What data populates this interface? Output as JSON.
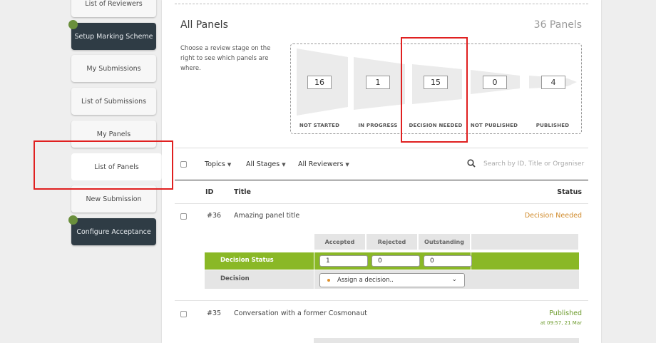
{
  "sidebar": {
    "items": [
      {
        "label": "List of Reviewers"
      },
      {
        "label": "Setup Marking Scheme"
      },
      {
        "label": "My Submissions"
      },
      {
        "label": "List of Submissions"
      },
      {
        "label": "My Panels"
      },
      {
        "label": "List of Panels"
      },
      {
        "label": "New Submission"
      },
      {
        "label": "Configure Acceptance"
      }
    ]
  },
  "header": {
    "title": "All Panels",
    "count": "36 Panels",
    "help": "Choose a review stage on the right to see which panels are where."
  },
  "stages": [
    {
      "label": "NOT STARTED",
      "count": "16"
    },
    {
      "label": "IN PROGRESS",
      "count": "1"
    },
    {
      "label": "DECISION NEEDED",
      "count": "15"
    },
    {
      "label": "NOT PUBLISHED",
      "count": "0"
    },
    {
      "label": "PUBLISHED",
      "count": "4"
    }
  ],
  "filters": {
    "topics": "Topics",
    "stages": "All Stages",
    "reviewers": "All Reviewers",
    "search_placeholder": "Search by ID, Title or Organiser"
  },
  "table": {
    "columns": {
      "id": "ID",
      "title": "Title",
      "status": "Status"
    },
    "rows": [
      {
        "id": "#36",
        "title": "Amazing panel title",
        "status": "Decision Needed",
        "status_color": "#d08a2a"
      },
      {
        "id": "#35",
        "title": "Conversation with a former Cosmonaut",
        "status": "Published",
        "status_time": "at 09:57, 21 Mar",
        "status_color": "#6b9a2a"
      }
    ]
  },
  "decision": {
    "headers": [
      "Accepted",
      "Rejected",
      "Outstanding"
    ],
    "status_label": "Decision Status",
    "values": [
      "1",
      "0",
      "0"
    ],
    "decision_label": "Decision",
    "select_value": "Assign a decision.."
  },
  "colors": {
    "sidebar_dark": "#2f3c45",
    "accent_green": "#8ab826",
    "highlight": "#e02020"
  }
}
